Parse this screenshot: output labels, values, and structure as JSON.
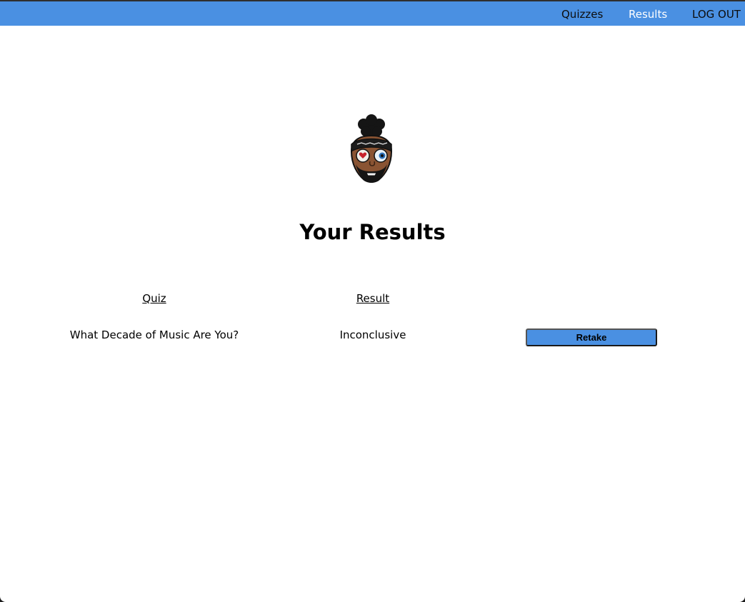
{
  "nav": {
    "items": [
      {
        "label": "Quizzes",
        "active": false
      },
      {
        "label": "Results",
        "active": true
      },
      {
        "label": "LOG OUT",
        "active": false
      }
    ]
  },
  "avatar": {
    "icon": "cartoon-avatar-with-headband-and-eyepatch-icon"
  },
  "page": {
    "title": "Your Results"
  },
  "table": {
    "headers": [
      "Quiz",
      "Result",
      ""
    ],
    "rows": [
      {
        "quiz": "What Decade of Music Are You?",
        "result": "Inconclusive",
        "action_label": "Retake"
      }
    ]
  },
  "colors": {
    "navbar": "#4a90e2",
    "active_nav_text": "#ffffff",
    "button": "#4a90e2"
  }
}
